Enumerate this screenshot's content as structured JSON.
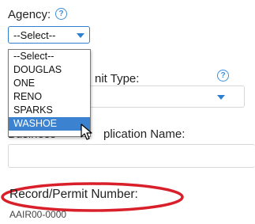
{
  "agency": {
    "label": "Agency:",
    "help_icon": "?",
    "selected": "--Select--",
    "options": [
      "--Select--",
      "DOUGLAS",
      "ONE",
      "RENO",
      "SPARKS",
      "WASHOE"
    ],
    "highlighted": "WASHOE"
  },
  "permit_type": {
    "label_visible": "nit Type:",
    "help_icon": "?"
  },
  "business_app": {
    "label_left": "Business",
    "label_visible": "plication Name:"
  },
  "record": {
    "label": "Record/Permit Number:",
    "value": "AAIR00-0000"
  },
  "colors": {
    "accent": "#2f7fd1",
    "highlight": "#3b82d0",
    "annotation": "#d81f2a"
  }
}
